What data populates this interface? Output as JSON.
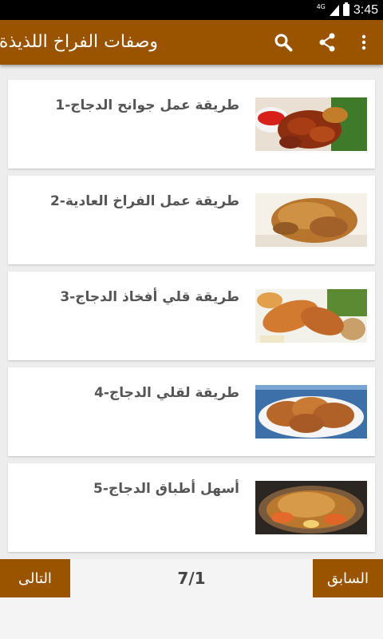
{
  "status_bar": {
    "network": "4G",
    "time": "3:45"
  },
  "app_bar": {
    "title": "وصفات الفراخ اللذيذة",
    "actions": [
      "search-icon",
      "share-icon",
      "more-vert-icon"
    ],
    "color": "#9a5400"
  },
  "recipes": [
    {
      "label": "1-طريقة عمل جوانح الدجاج",
      "image": "chicken-wings-with-sauce"
    },
    {
      "label": "2-طريقة عمل الفراخ العادية",
      "image": "roast-chicken-quarter"
    },
    {
      "label": "3-طريقة قلي أفخاذ الدجاج",
      "image": "fried-drumsticks"
    },
    {
      "label": "4-طريقة لقلي الدجاج",
      "image": "fried-chicken-plate"
    },
    {
      "label": "5-أسهل أطباق الدجاج",
      "image": "baked-chicken-dish"
    }
  ],
  "footer": {
    "next_label": "التالى",
    "prev_label": "السابق",
    "page_indicator": "7/1"
  }
}
